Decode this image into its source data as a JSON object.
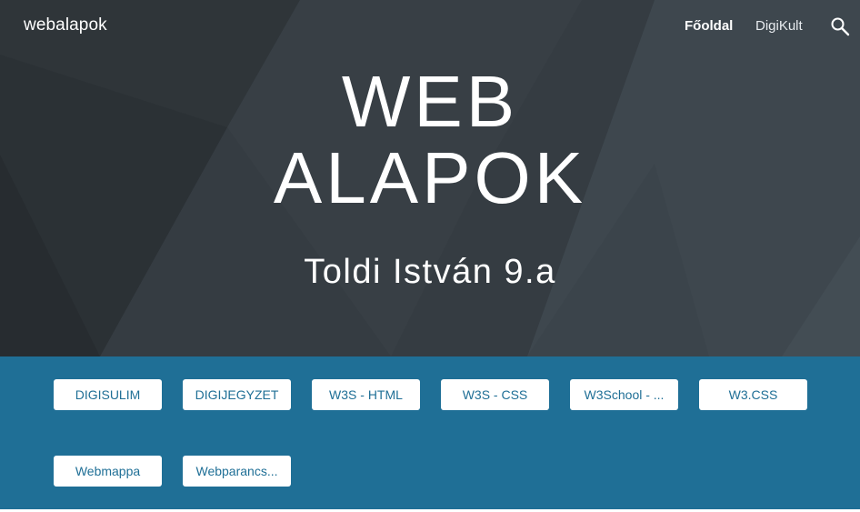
{
  "header": {
    "site_name": "webalapok",
    "nav": [
      {
        "label": "Főoldal",
        "active": true
      },
      {
        "label": "DigiKult",
        "active": false
      }
    ],
    "search_icon": "search-icon"
  },
  "hero": {
    "title_line1": "WEB",
    "title_line2": "ALAPOK",
    "subtitle": "Toldi István 9.a"
  },
  "buttons": [
    {
      "label": "DIGISULIM"
    },
    {
      "label": "DIGIJEGYZET"
    },
    {
      "label": "W3S - HTML"
    },
    {
      "label": "W3S - CSS"
    },
    {
      "label": "W3School - ..."
    },
    {
      "label": "W3.CSS"
    },
    {
      "label": "Webmappa"
    },
    {
      "label": "Webparancs..."
    }
  ],
  "colors": {
    "hero_bg": "#353c42",
    "section_bg": "#1f6f96",
    "button_text": "#1f6f96"
  }
}
